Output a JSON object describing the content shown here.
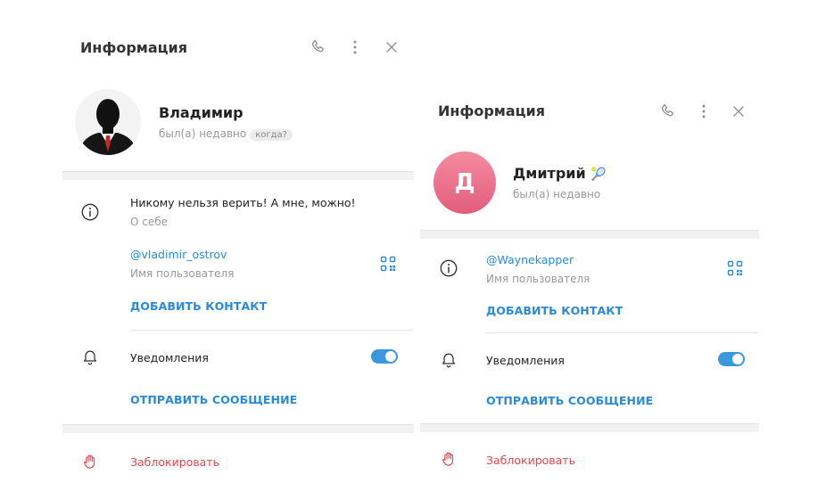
{
  "left_panel": {
    "header": {
      "title": "Информация",
      "icons": [
        "phone-icon",
        "more-vertical-icon",
        "close-icon"
      ]
    },
    "profile": {
      "name": "Владимир",
      "status": "был(а) недавно",
      "status_badge": "когда?"
    },
    "about": {
      "text": "Никому нельзя верить! А мне, можно!",
      "label": "О себе"
    },
    "username": {
      "value": "@vladimir_ostrov",
      "label": "Имя пользователя"
    },
    "add_contact": "ДОБАВИТЬ КОНТАКТ",
    "notifications": {
      "label": "Уведомления",
      "enabled": true
    },
    "send_message": "ОТПРАВИТЬ СООБЩЕНИЕ",
    "block": "Заблокировать"
  },
  "right_panel": {
    "header": {
      "title": "Информация",
      "icons": [
        "phone-icon",
        "more-vertical-icon",
        "close-icon"
      ]
    },
    "profile": {
      "name": "Дмитрий",
      "status": "был(а) недавно",
      "avatar_letter": "Д",
      "emoji": "🎾"
    },
    "username": {
      "value": "@Waynekapper",
      "label": "Имя пользователя"
    },
    "add_contact": "ДОБАВИТЬ КОНТАКТ",
    "notifications": {
      "label": "Уведомления",
      "enabled": true
    },
    "send_message": "ОТПРАВИТЬ СООБЩЕНИЕ",
    "block": "Заблокировать"
  },
  "colors": {
    "accent": "#2a8ad8",
    "danger": "#e0484f",
    "avatar_gradient_top": "#f58aa0",
    "avatar_gradient_bottom": "#e25d7c"
  }
}
